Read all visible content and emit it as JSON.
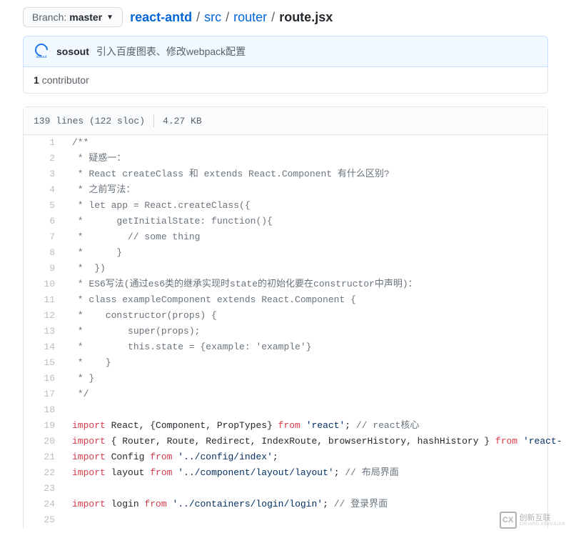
{
  "branch": {
    "label": "Branch:",
    "name": "master"
  },
  "breadcrumb": {
    "repo": "react-antd",
    "parts": [
      "src",
      "router"
    ],
    "file": "route.jsx"
  },
  "commit": {
    "author": "sosout",
    "avatar_label": "sosout",
    "message": "引入百度图表、修改webpack配置"
  },
  "contributors": {
    "count": "1",
    "label": "contributor"
  },
  "file_stats": {
    "lines": "139 lines (122 sloc)",
    "size": "4.27 KB"
  },
  "code_lines": [
    {
      "n": 1,
      "tokens": [
        {
          "t": "/**",
          "c": "tok-comment"
        }
      ]
    },
    {
      "n": 2,
      "tokens": [
        {
          "t": " * 疑惑一：",
          "c": "tok-comment"
        }
      ]
    },
    {
      "n": 3,
      "tokens": [
        {
          "t": " * React createClass 和 extends React.Component 有什么区别?",
          "c": "tok-comment"
        }
      ]
    },
    {
      "n": 4,
      "tokens": [
        {
          "t": " * 之前写法：",
          "c": "tok-comment"
        }
      ]
    },
    {
      "n": 5,
      "tokens": [
        {
          "t": " * let app = React.createClass({",
          "c": "tok-comment"
        }
      ]
    },
    {
      "n": 6,
      "tokens": [
        {
          "t": " *      getInitialState: function(){",
          "c": "tok-comment"
        }
      ]
    },
    {
      "n": 7,
      "tokens": [
        {
          "t": " *        // some thing",
          "c": "tok-comment"
        }
      ]
    },
    {
      "n": 8,
      "tokens": [
        {
          "t": " *      }",
          "c": "tok-comment"
        }
      ]
    },
    {
      "n": 9,
      "tokens": [
        {
          "t": " *  })",
          "c": "tok-comment"
        }
      ]
    },
    {
      "n": 10,
      "tokens": [
        {
          "t": " * ES6写法(通过es6类的继承实现时state的初始化要在constructor中声明)：",
          "c": "tok-comment"
        }
      ]
    },
    {
      "n": 11,
      "tokens": [
        {
          "t": " * class exampleComponent extends React.Component {",
          "c": "tok-comment"
        }
      ]
    },
    {
      "n": 12,
      "tokens": [
        {
          "t": " *    constructor(props) {",
          "c": "tok-comment"
        }
      ]
    },
    {
      "n": 13,
      "tokens": [
        {
          "t": " *        super(props);",
          "c": "tok-comment"
        }
      ]
    },
    {
      "n": 14,
      "tokens": [
        {
          "t": " *        this.state = {example: 'example'}",
          "c": "tok-comment"
        }
      ]
    },
    {
      "n": 15,
      "tokens": [
        {
          "t": " *    }",
          "c": "tok-comment"
        }
      ]
    },
    {
      "n": 16,
      "tokens": [
        {
          "t": " * }",
          "c": "tok-comment"
        }
      ]
    },
    {
      "n": 17,
      "tokens": [
        {
          "t": " */",
          "c": "tok-comment"
        }
      ]
    },
    {
      "n": 18,
      "tokens": [
        {
          "t": "",
          "c": ""
        }
      ]
    },
    {
      "n": 19,
      "tokens": [
        {
          "t": "import",
          "c": "tok-keyword"
        },
        {
          "t": " React, {Component, PropTypes} ",
          "c": ""
        },
        {
          "t": "from",
          "c": "tok-keyword"
        },
        {
          "t": " ",
          "c": ""
        },
        {
          "t": "'react'",
          "c": "tok-string"
        },
        {
          "t": "; ",
          "c": ""
        },
        {
          "t": "// react核心",
          "c": "tok-comment"
        }
      ]
    },
    {
      "n": 20,
      "tokens": [
        {
          "t": "import",
          "c": "tok-keyword"
        },
        {
          "t": " { Router, Route, Redirect, IndexRoute, browserHistory, hashHistory } ",
          "c": ""
        },
        {
          "t": "from",
          "c": "tok-keyword"
        },
        {
          "t": " ",
          "c": ""
        },
        {
          "t": "'react-",
          "c": "tok-string"
        }
      ]
    },
    {
      "n": 21,
      "tokens": [
        {
          "t": "import",
          "c": "tok-keyword"
        },
        {
          "t": " Config ",
          "c": ""
        },
        {
          "t": "from",
          "c": "tok-keyword"
        },
        {
          "t": " ",
          "c": ""
        },
        {
          "t": "'../config/index'",
          "c": "tok-string"
        },
        {
          "t": ";",
          "c": ""
        }
      ]
    },
    {
      "n": 22,
      "tokens": [
        {
          "t": "import",
          "c": "tok-keyword"
        },
        {
          "t": " layout ",
          "c": ""
        },
        {
          "t": "from",
          "c": "tok-keyword"
        },
        {
          "t": " ",
          "c": ""
        },
        {
          "t": "'../component/layout/layout'",
          "c": "tok-string"
        },
        {
          "t": "; ",
          "c": ""
        },
        {
          "t": "// 布局界面",
          "c": "tok-comment"
        }
      ]
    },
    {
      "n": 23,
      "tokens": [
        {
          "t": "",
          "c": ""
        }
      ]
    },
    {
      "n": 24,
      "tokens": [
        {
          "t": "import",
          "c": "tok-keyword"
        },
        {
          "t": " login ",
          "c": ""
        },
        {
          "t": "from",
          "c": "tok-keyword"
        },
        {
          "t": " ",
          "c": ""
        },
        {
          "t": "'../containers/login/login'",
          "c": "tok-string"
        },
        {
          "t": "; ",
          "c": ""
        },
        {
          "t": "// 登录界面",
          "c": "tok-comment"
        }
      ]
    },
    {
      "n": 25,
      "tokens": [
        {
          "t": "",
          "c": ""
        }
      ]
    }
  ],
  "watermark": {
    "icon": "CX",
    "text": "创新互联",
    "sub": "CHUANG XINHULIAN"
  }
}
